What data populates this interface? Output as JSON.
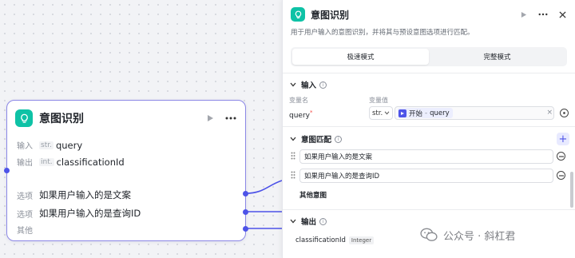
{
  "node": {
    "title": "意图识别",
    "input_label": "输入",
    "input_type": "str.",
    "input_value": "query",
    "output_label": "输出",
    "output_type": "int.",
    "output_value": "classificationId",
    "options": [
      {
        "label": "选项",
        "value": "如果用户输入的是文案"
      },
      {
        "label": "选项",
        "value": "如果用户输入的是查询ID"
      },
      {
        "label": "其他",
        "value": ""
      }
    ]
  },
  "panel": {
    "title": "意图识别",
    "description": "用于用户输入的意图识别，并将其与预设意图选项进行匹配。",
    "modes": {
      "fast": "极速模式",
      "full": "完整模式",
      "active": "fast"
    },
    "input_section": {
      "title": "输入",
      "col_name": "变量名",
      "col_value": "变量值",
      "var_name": "query",
      "required_mark": "*",
      "type": "str.",
      "ref_source": "开始",
      "ref_sep": "-",
      "ref_var": "query"
    },
    "intent_section": {
      "title": "意图匹配",
      "intents": [
        "如果用户输入的是文案",
        "如果用户输入的是查询ID"
      ],
      "other": "其他意图"
    },
    "output_section": {
      "title": "输出",
      "var_name": "classificationId",
      "type": "Integer"
    }
  },
  "watermark": {
    "text": "公众号 · 斜杠君"
  },
  "colors": {
    "accent": "#4d53e8",
    "node_icon": "#0ec2a6",
    "node_border": "#8b87e6"
  }
}
